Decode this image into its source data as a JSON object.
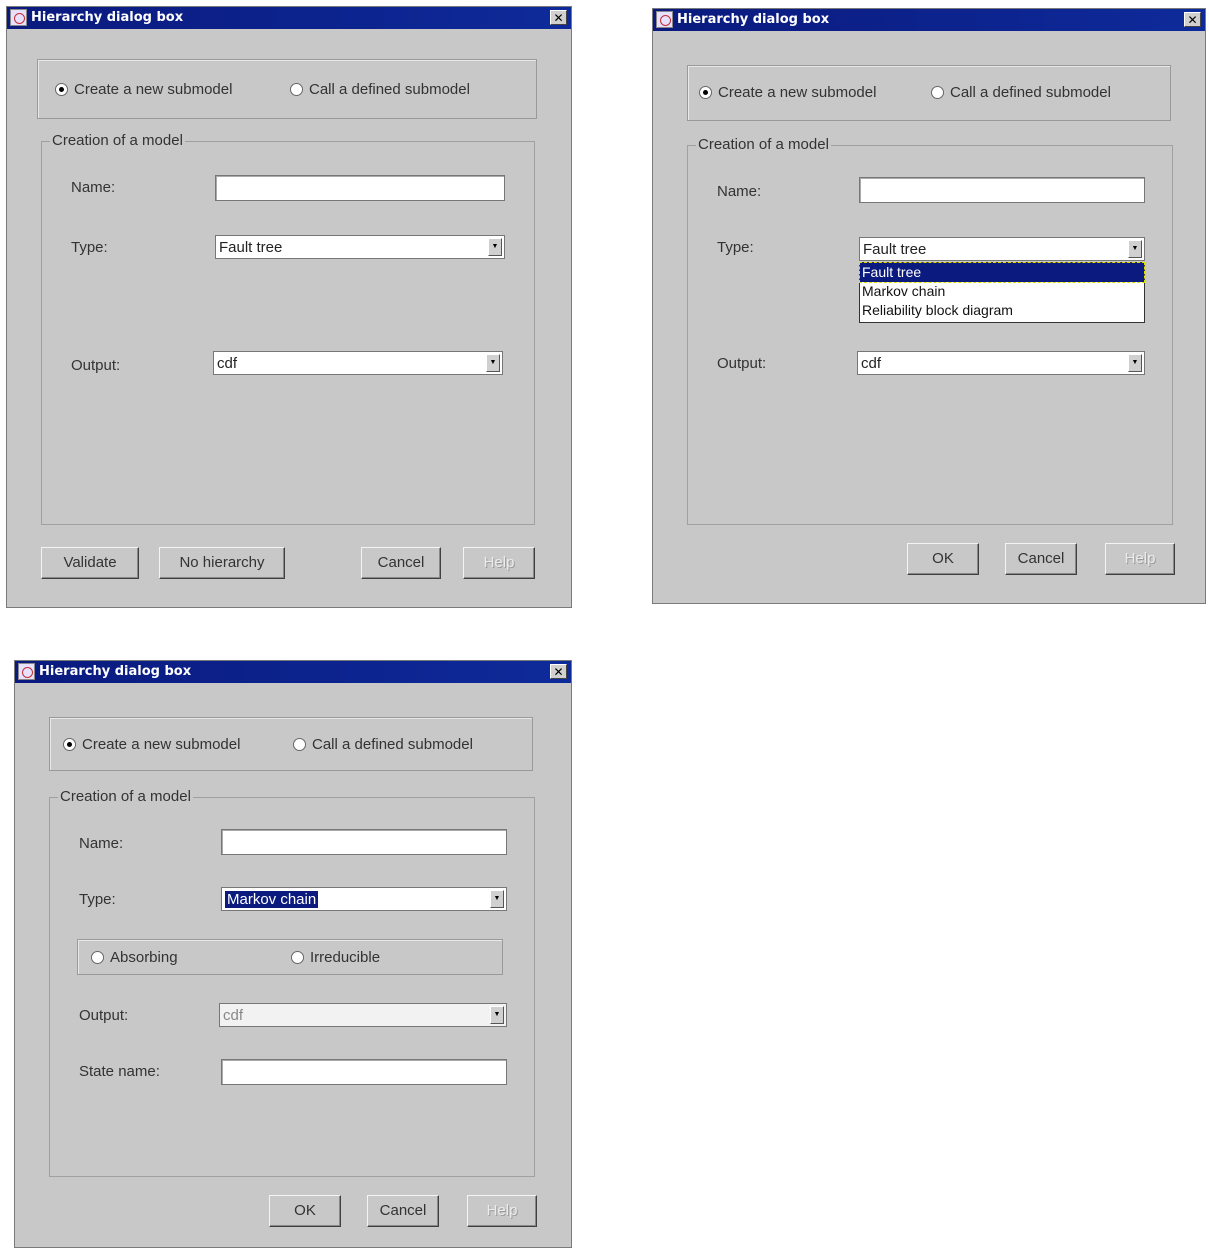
{
  "dialogs": [
    {
      "title": "Hierarchy dialog box",
      "close_glyph": "✕",
      "radio_create": "Create a new submodel",
      "radio_call": "Call a defined submodel",
      "group_title": "Creation of a model",
      "name_label": "Name:",
      "name_value": "",
      "type_label": "Type:",
      "type_value": "Fault tree",
      "output_label": "Output:",
      "output_value": "cdf",
      "buttons": {
        "validate": "Validate",
        "no_hierarchy": "No hierarchy",
        "cancel": "Cancel",
        "help": "Help"
      }
    },
    {
      "title": "Hierarchy dialog box",
      "close_glyph": "✕",
      "radio_create": "Create a new submodel",
      "radio_call": "Call a defined submodel",
      "group_title": "Creation of a model",
      "name_label": "Name:",
      "name_value": "",
      "type_label": "Type:",
      "type_value": "Fault tree",
      "type_options": [
        "Fault tree",
        "Markov chain",
        "Reliability block diagram"
      ],
      "output_label": "Output:",
      "output_value": "cdf",
      "buttons": {
        "ok": "OK",
        "cancel": "Cancel",
        "help": "Help"
      }
    },
    {
      "title": "Hierarchy dialog box",
      "close_glyph": "✕",
      "radio_create": "Create a new submodel",
      "radio_call": "Call a defined submodel",
      "group_title": "Creation of a model",
      "name_label": "Name:",
      "name_value": "",
      "type_label": "Type:",
      "type_value": "Markov chain",
      "radio_absorbing": "Absorbing",
      "radio_irreducible": "Irreducible",
      "output_label": "Output:",
      "output_value": "cdf",
      "state_label": "State name:",
      "state_value": "",
      "buttons": {
        "ok": "OK",
        "cancel": "Cancel",
        "help": "Help"
      }
    }
  ],
  "icons": {
    "title_icon": "java-app-icon",
    "close": "close-icon",
    "combo_arrow": "chevron-down-icon"
  },
  "colors": {
    "titlebar": "#0a1a7e",
    "dialog_bg": "#c8c8c8",
    "selection": "#0a1a7e"
  }
}
